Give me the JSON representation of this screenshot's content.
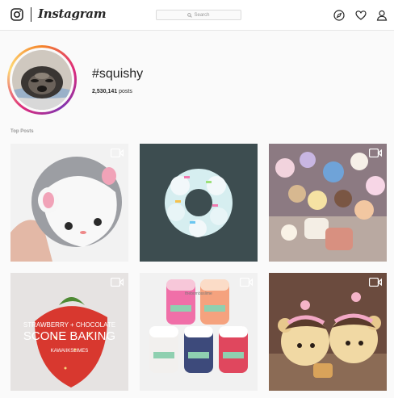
{
  "header": {
    "brand": "Instagram",
    "search_placeholder": "Search",
    "nav_icons": [
      "compass-icon",
      "heart-icon",
      "person-icon"
    ]
  },
  "tag": {
    "name": "#squishy",
    "post_count": "2,530,141",
    "post_label": "posts"
  },
  "sections": {
    "top_posts": "Top Posts"
  },
  "posts": [
    {
      "subject": "hamster squishy",
      "video": true
    },
    {
      "subject": "donut squishy",
      "video": false
    },
    {
      "subject": "squishy collection",
      "video": true
    },
    {
      "subject": "strawberry squishy",
      "video": true,
      "overlay_small": "STRAWBERRY + CHOCOLATE",
      "overlay_big": "SCONE BAKING",
      "overlay_credit": "KAWAIIKSLIMES"
    },
    {
      "subject": "slime jars",
      "video": true,
      "overlay_credit": "thebombsslime"
    },
    {
      "subject": "bear squishies",
      "video": true
    }
  ],
  "colors": {
    "accent_ring": [
      "#f58529",
      "#dd2a7b",
      "#8134af"
    ],
    "muted_text": "#999999"
  }
}
